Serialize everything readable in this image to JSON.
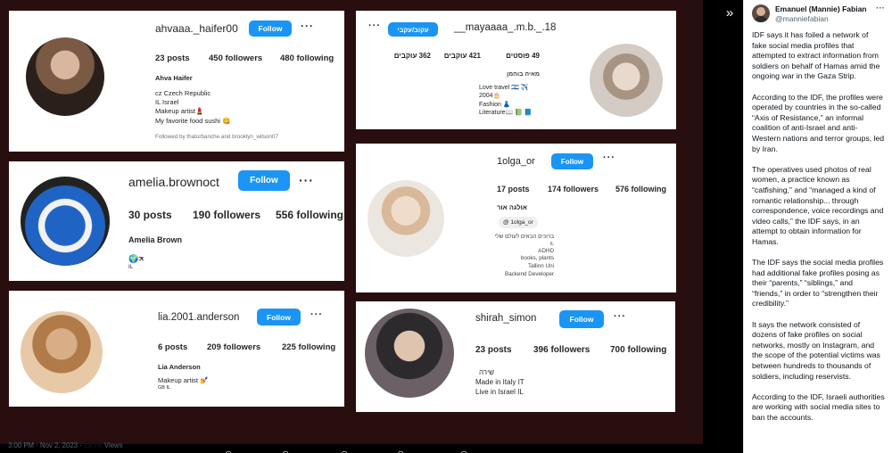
{
  "viewer": {
    "expand_icon": "»"
  },
  "profiles": {
    "p1": {
      "username": "ahvaaa._haifer00",
      "follow_label": "Follow",
      "posts": "23 posts",
      "followers": "450 followers",
      "following": "480 following",
      "name": "Ahva Haifer",
      "bio": [
        "cz Czech Republic",
        "IL Israel",
        "Makeup artist💄",
        "My favorite food sushi 😋"
      ],
      "followed_by": "Followed by thaturbanche and brooklyn_wilson07"
    },
    "p2": {
      "username": "__mayaaaa_.m.b._.18",
      "follow_label": "עקוב/עקבי",
      "posts": "49 פוסטים",
      "followers": "421 עוקבים",
      "following": "362 עוקבים",
      "name": "מאיה בוהמן",
      "bio": [
        "Love travel 🇮🇱 ✈️",
        "2004🎂",
        "Fashion 👗",
        "Literature📖 📗 📘"
      ]
    },
    "p3": {
      "username": "amelia.brownoct",
      "follow_label": "Follow",
      "posts": "30 posts",
      "followers": "190 followers",
      "following": "556 following",
      "name": "Amelia Brown",
      "bio": [
        "🌍🛪",
        "IL"
      ]
    },
    "p4": {
      "username": "1olga_or",
      "follow_label": "Follow",
      "posts": "17 posts",
      "followers": "174 followers",
      "following": "576 following",
      "name": "אולגה אור",
      "threads": "1olga_or",
      "bio": [
        "ברוכים הבאים לעולם שלי",
        "IL",
        "ADHD",
        "books, plants",
        "Tallinn Uni",
        "Backend Developer"
      ]
    },
    "p5": {
      "username": "lia.2001.anderson",
      "follow_label": "Follow",
      "posts": "6 posts",
      "followers": "209 followers",
      "following": "225 following",
      "name": "Lia Anderson",
      "bio": [
        "Makeup artist 💅",
        "GB IL"
      ]
    },
    "p6": {
      "username": "shirah_simon",
      "follow_label": "Follow",
      "posts": "23 posts",
      "followers": "396 followers",
      "following": "700 following",
      "name": "שירה",
      "bio": [
        "Made in Italy IT",
        "Live in Israel IL"
      ]
    }
  },
  "tweet": {
    "display_name": "Emanuel (Mannie) Fabian",
    "handle": "@manniefabian",
    "more_icon": "···",
    "paragraphs": [
      "IDF says it has foiled a network of fake social media profiles that attempted to extract information from soldiers on behalf of Hamas amid the ongoing war in the Gaza Strip.",
      "According to the IDF, the profiles were operated by countries in the so-called “Axis of Resistance,” an informal coalition of anti-Israel and anti-Western nations and terror groups, led by Iran.",
      "The operatives used photos of real women, a practice known as “catfishing,” and “managed a kind of romantic relationship... through correspondence, voice recordings and video calls,” the IDF says, in an attempt to obtain information for Hamas.",
      "The IDF says the social media profiles had additional fake profiles posing as their “parents,” “siblings,” and “friends,” in order to “strengthen their credibility.”",
      "It says the network consisted of dozens of fake profiles on social networks, mostly on Instagram, and the scope of the potential victims was between hundreds to thousands of soldiers, including reservists.",
      "According to the IDF, Israeli authorities are working with social media sites to ban the accounts."
    ],
    "time": "3:00 PM · Nov 2, 2023 · ",
    "views_count": "19.7K",
    "views_label": " Views"
  },
  "colors": {
    "follow_blue": "#1a95f5",
    "background": "#290e10"
  }
}
